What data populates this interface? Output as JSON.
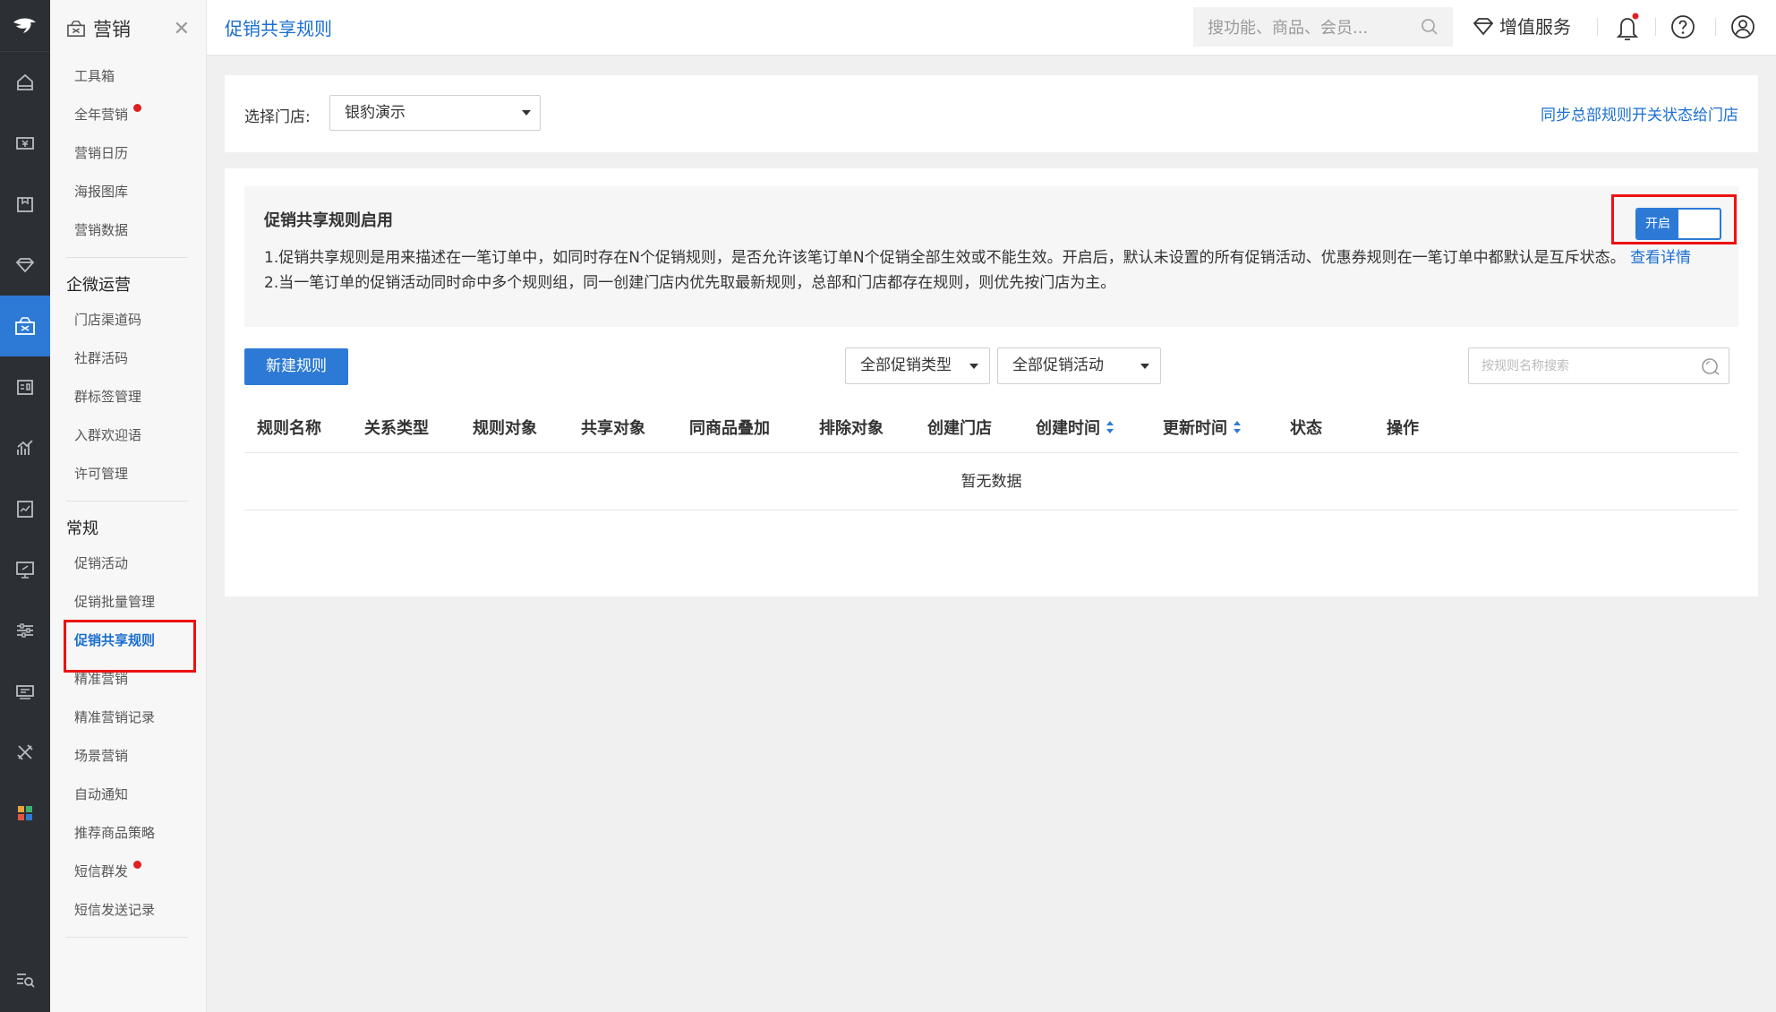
{
  "rail": {
    "icons": [
      "home-icon",
      "cash-icon",
      "goods-icon",
      "member-icon",
      "marketing-icon",
      "crm-icon",
      "report-icon",
      "finance-icon",
      "display-icon",
      "settings-icon",
      "device-icon",
      "tools-icon",
      "apps-icon"
    ],
    "active": "marketing-icon"
  },
  "menu": {
    "title": "营销",
    "top_items": [
      {
        "label": "工具箱",
        "dot": false
      },
      {
        "label": "全年营销",
        "dot": true
      },
      {
        "label": "营销日历",
        "dot": false
      },
      {
        "label": "海报图库",
        "dot": false
      },
      {
        "label": "营销数据",
        "dot": false
      }
    ],
    "groups": [
      {
        "title": "企微运营",
        "items": [
          {
            "label": "门店渠道码",
            "dot": false
          },
          {
            "label": "社群活码",
            "dot": false
          },
          {
            "label": "群标签管理",
            "dot": false
          },
          {
            "label": "入群欢迎语",
            "dot": false
          },
          {
            "label": "许可管理",
            "dot": false
          }
        ]
      },
      {
        "title": "常规",
        "items": [
          {
            "label": "促销活动",
            "dot": false
          },
          {
            "label": "促销批量管理",
            "dot": false
          },
          {
            "label": "促销共享规则",
            "dot": false,
            "active": true
          },
          {
            "label": "精准营销",
            "dot": false
          },
          {
            "label": "精准营销记录",
            "dot": false
          },
          {
            "label": "场景营销",
            "dot": false
          },
          {
            "label": "自动通知",
            "dot": false
          },
          {
            "label": "推荐商品策略",
            "dot": false
          },
          {
            "label": "短信群发",
            "dot": true
          },
          {
            "label": "短信发送记录",
            "dot": false
          }
        ]
      }
    ]
  },
  "header": {
    "page_title": "促销共享规则",
    "search_placeholder": "搜功能、商品、会员...",
    "vip_label": "增值服务"
  },
  "store": {
    "label": "选择门店:",
    "selected": "银豹演示",
    "sync_link": "同步总部规则开关状态给门店"
  },
  "info": {
    "title": "促销共享规则启用",
    "line1": "1.促销共享规则是用来描述在一笔订单中，如同时存在N个促销规则，是否允许该笔订单N个促销全部生效或不能生效。开启后，默认未设置的所有促销活动、优惠券规则在一笔订单中都默认是互斥状态。",
    "detail_link": "查看详情",
    "line2": "2.当一笔订单的促销活动同时命中多个规则组，同一创建门店内优先取最新规则，总部和门店都存在规则，则优先按门店为主。",
    "switch_label": "开启",
    "switch_on": true
  },
  "toolbar": {
    "new_button": "新建规则",
    "type_filter": "全部促销类型",
    "activity_filter": "全部促销活动",
    "search_placeholder": "按规则名称搜索"
  },
  "table": {
    "columns": [
      "规则名称",
      "关系类型",
      "规则对象",
      "共享对象",
      "同商品叠加",
      "排除对象",
      "创建门店",
      "创建时间",
      "更新时间",
      "状态",
      "操作"
    ],
    "sortable": [
      "创建时间",
      "更新时间"
    ],
    "empty_text": "暂无数据"
  },
  "colors": {
    "primary": "#2d7ad6",
    "link": "#1a6fd0",
    "highlight": "#e11111",
    "rail_bg": "#2c2f33"
  }
}
